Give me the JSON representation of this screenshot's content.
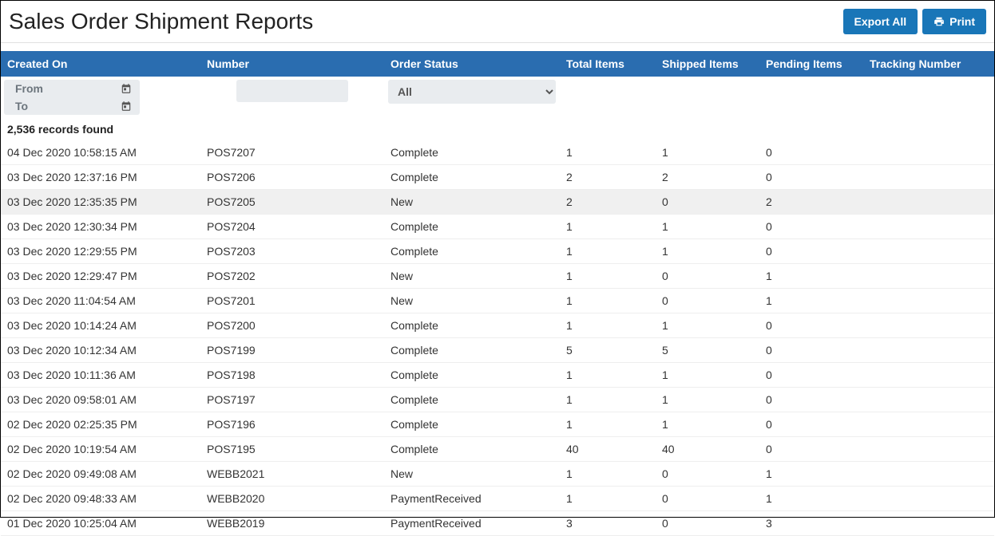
{
  "header": {
    "title": "Sales Order Shipment Reports",
    "export_all_label": "Export All",
    "print_label": "Print"
  },
  "table": {
    "columns": {
      "created_on": "Created On",
      "number": "Number",
      "order_status": "Order Status",
      "total_items": "Total Items",
      "shipped_items": "Shipped Items",
      "pending_items": "Pending Items",
      "tracking_number": "Tracking Number"
    },
    "filters": {
      "from_label": "From",
      "to_label": "To",
      "status_selected": "All",
      "status_options": [
        "All"
      ]
    },
    "records_found": "2,536 records found",
    "rows": [
      {
        "created_on": "04 Dec 2020 10:58:15 AM",
        "number": "POS7207",
        "order_status": "Complete",
        "total_items": "1",
        "shipped_items": "1",
        "pending_items": "0",
        "tracking_number": "",
        "hl": false
      },
      {
        "created_on": "03 Dec 2020 12:37:16 PM",
        "number": "POS7206",
        "order_status": "Complete",
        "total_items": "2",
        "shipped_items": "2",
        "pending_items": "0",
        "tracking_number": "",
        "hl": false
      },
      {
        "created_on": "03 Dec 2020 12:35:35 PM",
        "number": "POS7205",
        "order_status": "New",
        "total_items": "2",
        "shipped_items": "0",
        "pending_items": "2",
        "tracking_number": "",
        "hl": true
      },
      {
        "created_on": "03 Dec 2020 12:30:34 PM",
        "number": "POS7204",
        "order_status": "Complete",
        "total_items": "1",
        "shipped_items": "1",
        "pending_items": "0",
        "tracking_number": "",
        "hl": false
      },
      {
        "created_on": "03 Dec 2020 12:29:55 PM",
        "number": "POS7203",
        "order_status": "Complete",
        "total_items": "1",
        "shipped_items": "1",
        "pending_items": "0",
        "tracking_number": "",
        "hl": false
      },
      {
        "created_on": "03 Dec 2020 12:29:47 PM",
        "number": "POS7202",
        "order_status": "New",
        "total_items": "1",
        "shipped_items": "0",
        "pending_items": "1",
        "tracking_number": "",
        "hl": false
      },
      {
        "created_on": "03 Dec 2020 11:04:54 AM",
        "number": "POS7201",
        "order_status": "New",
        "total_items": "1",
        "shipped_items": "0",
        "pending_items": "1",
        "tracking_number": "",
        "hl": false
      },
      {
        "created_on": "03 Dec 2020 10:14:24 AM",
        "number": "POS7200",
        "order_status": "Complete",
        "total_items": "1",
        "shipped_items": "1",
        "pending_items": "0",
        "tracking_number": "",
        "hl": false
      },
      {
        "created_on": "03 Dec 2020 10:12:34 AM",
        "number": "POS7199",
        "order_status": "Complete",
        "total_items": "5",
        "shipped_items": "5",
        "pending_items": "0",
        "tracking_number": "",
        "hl": false
      },
      {
        "created_on": "03 Dec 2020 10:11:36 AM",
        "number": "POS7198",
        "order_status": "Complete",
        "total_items": "1",
        "shipped_items": "1",
        "pending_items": "0",
        "tracking_number": "",
        "hl": false
      },
      {
        "created_on": "03 Dec 2020 09:58:01 AM",
        "number": "POS7197",
        "order_status": "Complete",
        "total_items": "1",
        "shipped_items": "1",
        "pending_items": "0",
        "tracking_number": "",
        "hl": false
      },
      {
        "created_on": "02 Dec 2020 02:25:35 PM",
        "number": "POS7196",
        "order_status": "Complete",
        "total_items": "1",
        "shipped_items": "1",
        "pending_items": "0",
        "tracking_number": "",
        "hl": false
      },
      {
        "created_on": "02 Dec 2020 10:19:54 AM",
        "number": "POS7195",
        "order_status": "Complete",
        "total_items": "40",
        "shipped_items": "40",
        "pending_items": "0",
        "tracking_number": "",
        "hl": false
      },
      {
        "created_on": "02 Dec 2020 09:49:08 AM",
        "number": "WEBB2021",
        "order_status": "New",
        "total_items": "1",
        "shipped_items": "0",
        "pending_items": "1",
        "tracking_number": "",
        "hl": false
      },
      {
        "created_on": "02 Dec 2020 09:48:33 AM",
        "number": "WEBB2020",
        "order_status": "PaymentReceived",
        "total_items": "1",
        "shipped_items": "0",
        "pending_items": "1",
        "tracking_number": "",
        "hl": false
      },
      {
        "created_on": "01 Dec 2020 10:25:04 AM",
        "number": "WEBB2019",
        "order_status": "PaymentReceived",
        "total_items": "3",
        "shipped_items": "0",
        "pending_items": "3",
        "tracking_number": "",
        "hl": false
      }
    ]
  }
}
